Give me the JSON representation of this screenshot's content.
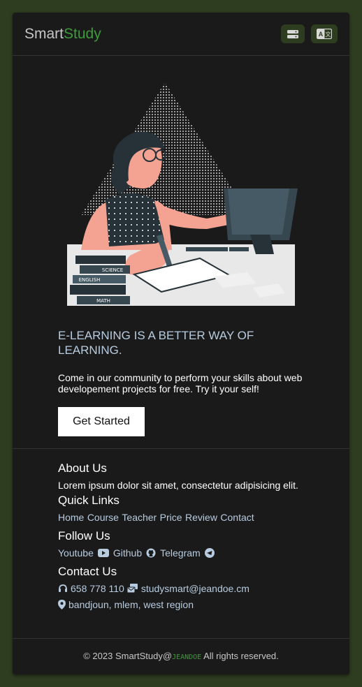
{
  "header": {
    "logo_part1": "Smart",
    "logo_part2": "Study",
    "menu_icon": "server-toggle-icon",
    "translate_icon": "translate-icon"
  },
  "hero": {
    "illustration_text": [
      "SCIENCE",
      "ENGLISH",
      "MATH"
    ],
    "title": "E-LEARNING IS A BETTER WAY OF LEARNING.",
    "text": "Come in our community to perform your skills about web developement projects for free. Try it your self!",
    "cta_label": "Get Started"
  },
  "about": {
    "heading": "About Us",
    "text": "Lorem ipsum dolor sit amet, consectetur adipisicing elit."
  },
  "quick_links": {
    "heading": "Quick Links",
    "items": [
      "Home",
      "Course",
      "Teacher",
      "Price",
      "Review",
      "Contact"
    ]
  },
  "follow": {
    "heading": "Follow Us",
    "items": [
      {
        "label": "Youtube",
        "icon": "youtube-icon"
      },
      {
        "label": "Github",
        "icon": "github-icon"
      },
      {
        "label": "Telegram",
        "icon": "telegram-icon"
      }
    ]
  },
  "contact": {
    "heading": "Contact Us",
    "phone": "658 778 110",
    "email": "studysmart@jeandoe.cm",
    "address": "bandjoun, mlem, west region"
  },
  "footer": {
    "copyright_prefix": "© 2023 SmartStudy@",
    "brand": "JEANDOE",
    "copyright_suffix": " All rights reserved."
  },
  "colors": {
    "page_bg": "#2e3d20",
    "card_bg": "#1a1a1a",
    "accent_green": "#3e9a3a",
    "link_blue": "#b8cce0"
  }
}
